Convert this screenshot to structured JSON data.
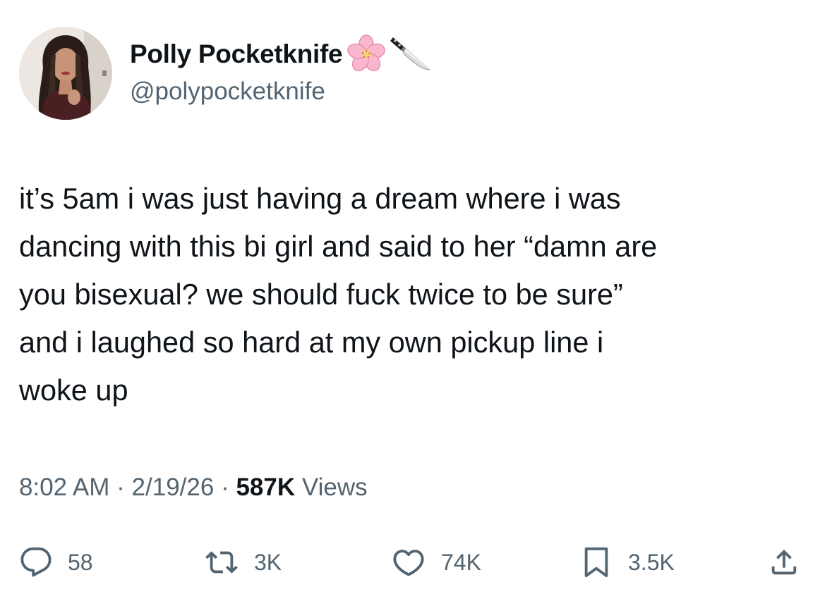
{
  "author": {
    "display_name": "Polly Pocketknife",
    "handle": "@polypocketknife",
    "name_emojis": [
      "cherry-blossom-icon",
      "kitchen-knife-icon"
    ]
  },
  "tweet": {
    "text": "it’s 5am i was just having a dream where i was\ndancing with this bi girl and said to her “damn are\nyou bisexual? we should fuck twice to be sure”\nand i laughed so hard at my own pickup line i\nwoke up",
    "time": "8:02 AM",
    "date": "2/19/26",
    "views_count": "587K",
    "views_label": "Views",
    "separator": "·"
  },
  "actions": {
    "replies": "58",
    "reposts": "3K",
    "likes": "74K",
    "bookmarks": "3.5K"
  },
  "colors": {
    "text_primary": "#0f1419",
    "text_secondary": "#536471",
    "background": "#ffffff"
  }
}
